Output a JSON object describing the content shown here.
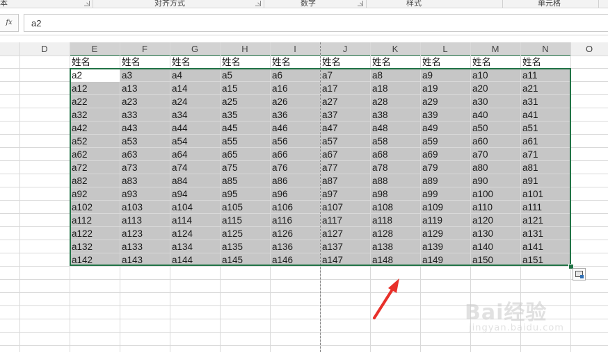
{
  "ribbon": {
    "groups": [
      {
        "label": "本"
      },
      {
        "label": "对齐方式"
      },
      {
        "label": "数字"
      },
      {
        "label": "样式"
      },
      {
        "label": "单元格"
      }
    ]
  },
  "formula_bar": {
    "fx_label": "fx",
    "value": "a2"
  },
  "columns": [
    "D",
    "E",
    "F",
    "G",
    "H",
    "I",
    "J",
    "K",
    "L",
    "M",
    "N",
    "O"
  ],
  "header_row": [
    "姓名",
    "姓名",
    "姓名",
    "姓名",
    "姓名",
    "姓名",
    "姓名",
    "姓名",
    "姓名",
    "姓名"
  ],
  "data_rows": [
    [
      "a2",
      "a3",
      "a4",
      "a5",
      "a6",
      "a7",
      "a8",
      "a9",
      "a10",
      "a11"
    ],
    [
      "a12",
      "a13",
      "a14",
      "a15",
      "a16",
      "a17",
      "a18",
      "a19",
      "a20",
      "a21"
    ],
    [
      "a22",
      "a23",
      "a24",
      "a25",
      "a26",
      "a27",
      "a28",
      "a29",
      "a30",
      "a31"
    ],
    [
      "a32",
      "a33",
      "a34",
      "a35",
      "a36",
      "a37",
      "a38",
      "a39",
      "a40",
      "a41"
    ],
    [
      "a42",
      "a43",
      "a44",
      "a45",
      "a46",
      "a47",
      "a48",
      "a49",
      "a50",
      "a51"
    ],
    [
      "a52",
      "a53",
      "a54",
      "a55",
      "a56",
      "a57",
      "a58",
      "a59",
      "a60",
      "a61"
    ],
    [
      "a62",
      "a63",
      "a64",
      "a65",
      "a66",
      "a67",
      "a68",
      "a69",
      "a70",
      "a71"
    ],
    [
      "a72",
      "a73",
      "a74",
      "a75",
      "a76",
      "a77",
      "a78",
      "a79",
      "a80",
      "a81"
    ],
    [
      "a82",
      "a83",
      "a84",
      "a85",
      "a86",
      "a87",
      "a88",
      "a89",
      "a90",
      "a91"
    ],
    [
      "a92",
      "a93",
      "a94",
      "a95",
      "a96",
      "a97",
      "a98",
      "a99",
      "a100",
      "a101"
    ],
    [
      "a102",
      "a103",
      "a104",
      "a105",
      "a106",
      "a107",
      "a108",
      "a109",
      "a110",
      "a111"
    ],
    [
      "a112",
      "a113",
      "a114",
      "a115",
      "a116",
      "a117",
      "a118",
      "a119",
      "a120",
      "a121"
    ],
    [
      "a122",
      "a123",
      "a124",
      "a125",
      "a126",
      "a127",
      "a128",
      "a129",
      "a130",
      "a131"
    ],
    [
      "a132",
      "a133",
      "a134",
      "a135",
      "a136",
      "a137",
      "a138",
      "a139",
      "a140",
      "a141"
    ],
    [
      "a142",
      "a143",
      "a144",
      "a145",
      "a146",
      "a147",
      "a148",
      "a149",
      "a150",
      "a151"
    ]
  ],
  "selected_columns": [
    "E",
    "F",
    "G",
    "H",
    "I",
    "J",
    "K",
    "L",
    "M",
    "N"
  ],
  "watermark": {
    "brand": "Bai经验",
    "url": "jingyan.baidu.com"
  },
  "colors": {
    "selection_border": "#217346",
    "selection_fill": "#c6c6c6",
    "annotation_arrow": "#e8302a"
  },
  "icons": {
    "quick_analysis": "quick-analysis-icon",
    "annotation": "red-arrow-icon"
  }
}
